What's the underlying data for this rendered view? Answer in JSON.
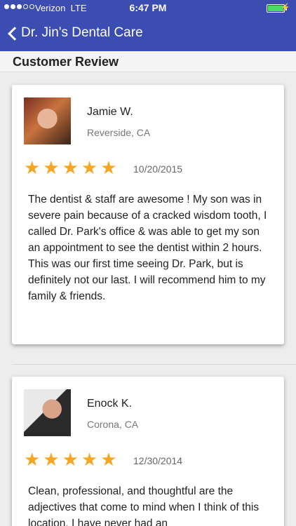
{
  "status_bar": {
    "carrier": "Verizon",
    "network": "LTE",
    "time": "6:47 PM",
    "signal_bars": 3,
    "signal_total": 5
  },
  "nav": {
    "title": "Dr. Jin's Dental Care"
  },
  "section": {
    "title": "Customer Review"
  },
  "reviews": [
    {
      "name": "Jamie W.",
      "location": "Reverside, CA",
      "rating": 5,
      "stars": "★★★★★",
      "date": "10/20/2015",
      "text": "The dentist & staff are awesome ! My son was in severe pain because of a cracked wisdom tooth, I called Dr. Park's office & was able to get my son an appointment to see the dentist within 2 hours. This was our first time seeing Dr. Park, but is definitely not our last. I will recommend him to my family & friends."
    },
    {
      "name": "Enock K.",
      "location": "Corona, CA",
      "rating": 5,
      "stars": "★★★★★",
      "date": "12/30/2014",
      "text": "Clean, professional, and thoughtful are the adjectives that come to mind when I think of this location. I have never had an"
    }
  ],
  "colors": {
    "nav_bg": "#3c4db2",
    "star": "#f5a623",
    "battery": "#4cd964"
  }
}
